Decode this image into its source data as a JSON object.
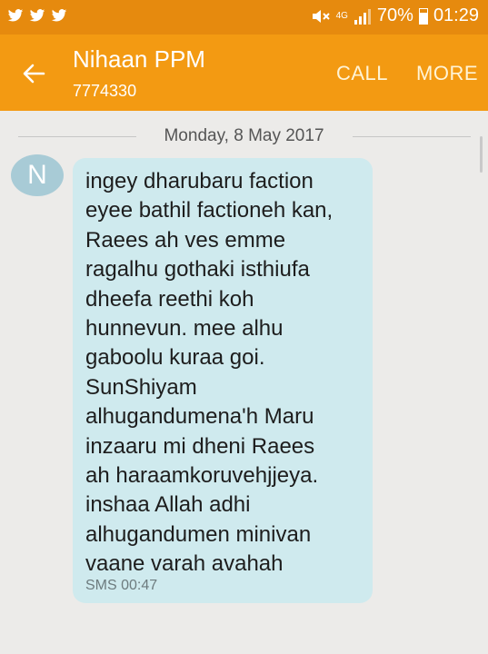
{
  "status_bar": {
    "network": "4G",
    "battery": "70%",
    "time": "01:29",
    "left_icons": [
      "twitter-icon",
      "twitter-icon",
      "twitter-icon"
    ]
  },
  "header": {
    "contact_name": "Nihaan PPM",
    "contact_number": "7774330",
    "call_label": "CALL",
    "more_label": "MORE"
  },
  "conversation": {
    "date": "Monday, 8 May 2017",
    "avatar_letter": "N",
    "message": {
      "text": "ingey dharubaru faction\neyee bathil factioneh kan,\nRaees  ah ves emme\nragalhu gothaki isthiufa\ndheefa reethi koh\nhunnevun. mee alhu\ngaboolu kuraa goi.\nSunShiyam\nalhugandumena'h Maru\ninzaaru mi dheni Raees\nah haraamkoruvehjjeya.\ninshaa Allah adhi\nalhugandumen minivan\nvaane varah avahah",
      "meta": "SMS 00:47"
    }
  },
  "colors": {
    "status_bar": "#e68a0e",
    "app_bar": "#f39a12",
    "bubble": "#cfeaee",
    "avatar": "#a8cbd6",
    "background": "#ecebe9"
  }
}
